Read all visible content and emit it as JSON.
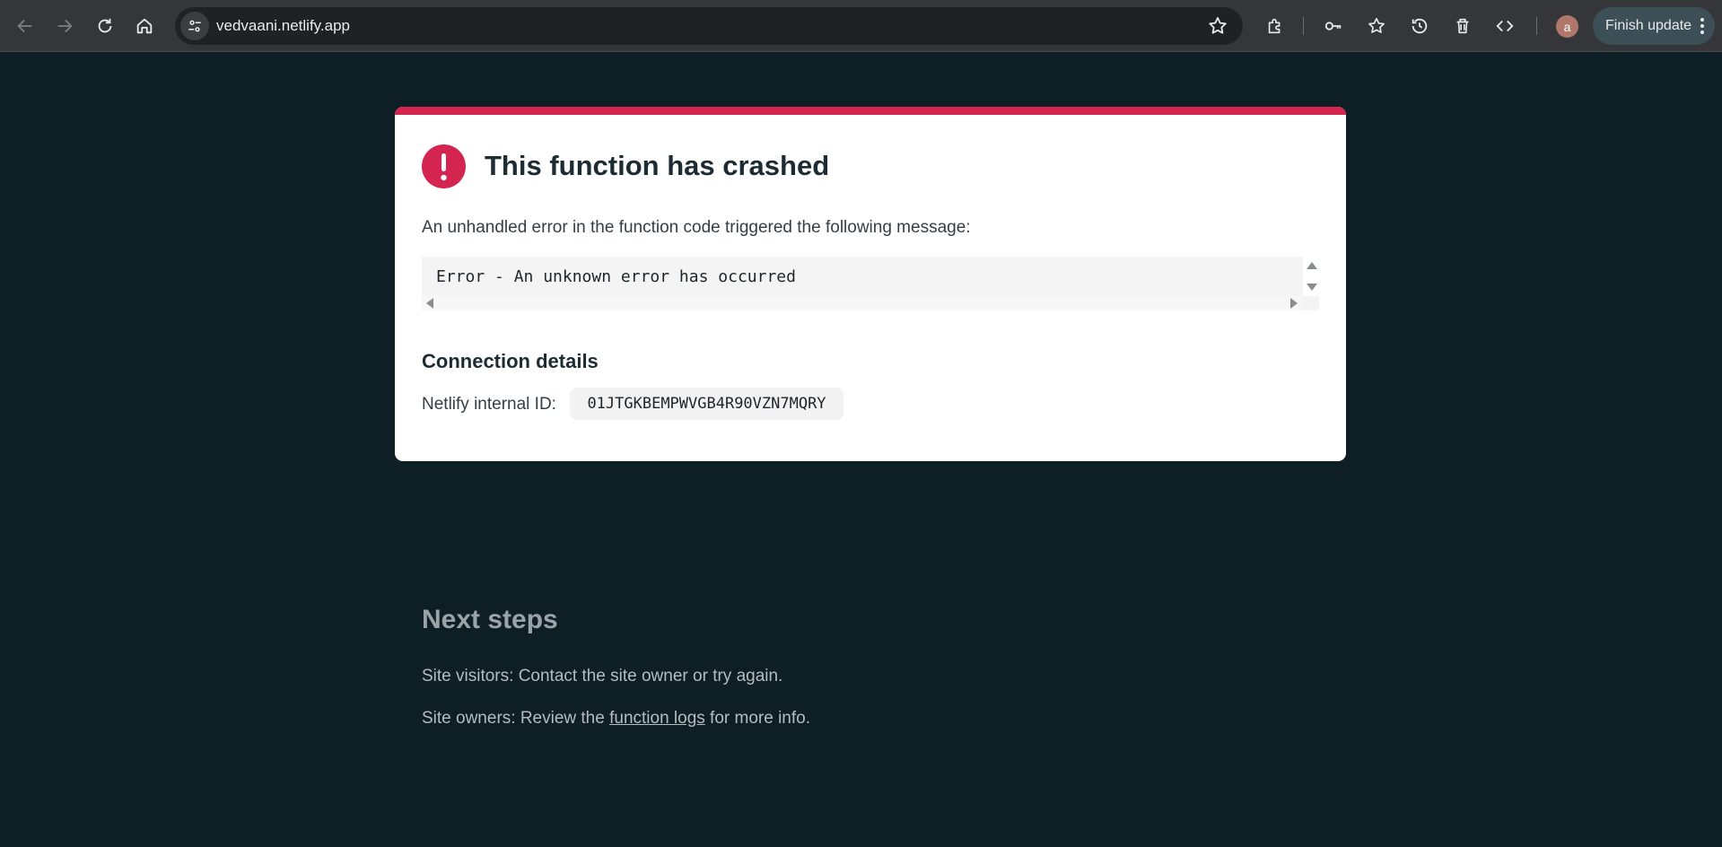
{
  "browser": {
    "url": "vedvaani.netlify.app",
    "avatar_letter": "a",
    "finish_update_label": "Finish update",
    "accent_color": "#3c4f56"
  },
  "error_card": {
    "title": "This function has crashed",
    "description": "An unhandled error in the function code triggered the following message:",
    "error_message": "Error - An unknown error has occurred",
    "connection_heading": "Connection details",
    "internal_id_label": "Netlify internal ID:",
    "internal_id": "01JTGKBEMPWVGB4R90VZN7MQRY",
    "accent_color": "#d3254f"
  },
  "next_steps": {
    "title": "Next steps",
    "visitors_text": "Site visitors: Contact the site owner or try again.",
    "owners_prefix": "Site owners: Review the ",
    "owners_link": "function logs",
    "owners_suffix": " for more info."
  }
}
